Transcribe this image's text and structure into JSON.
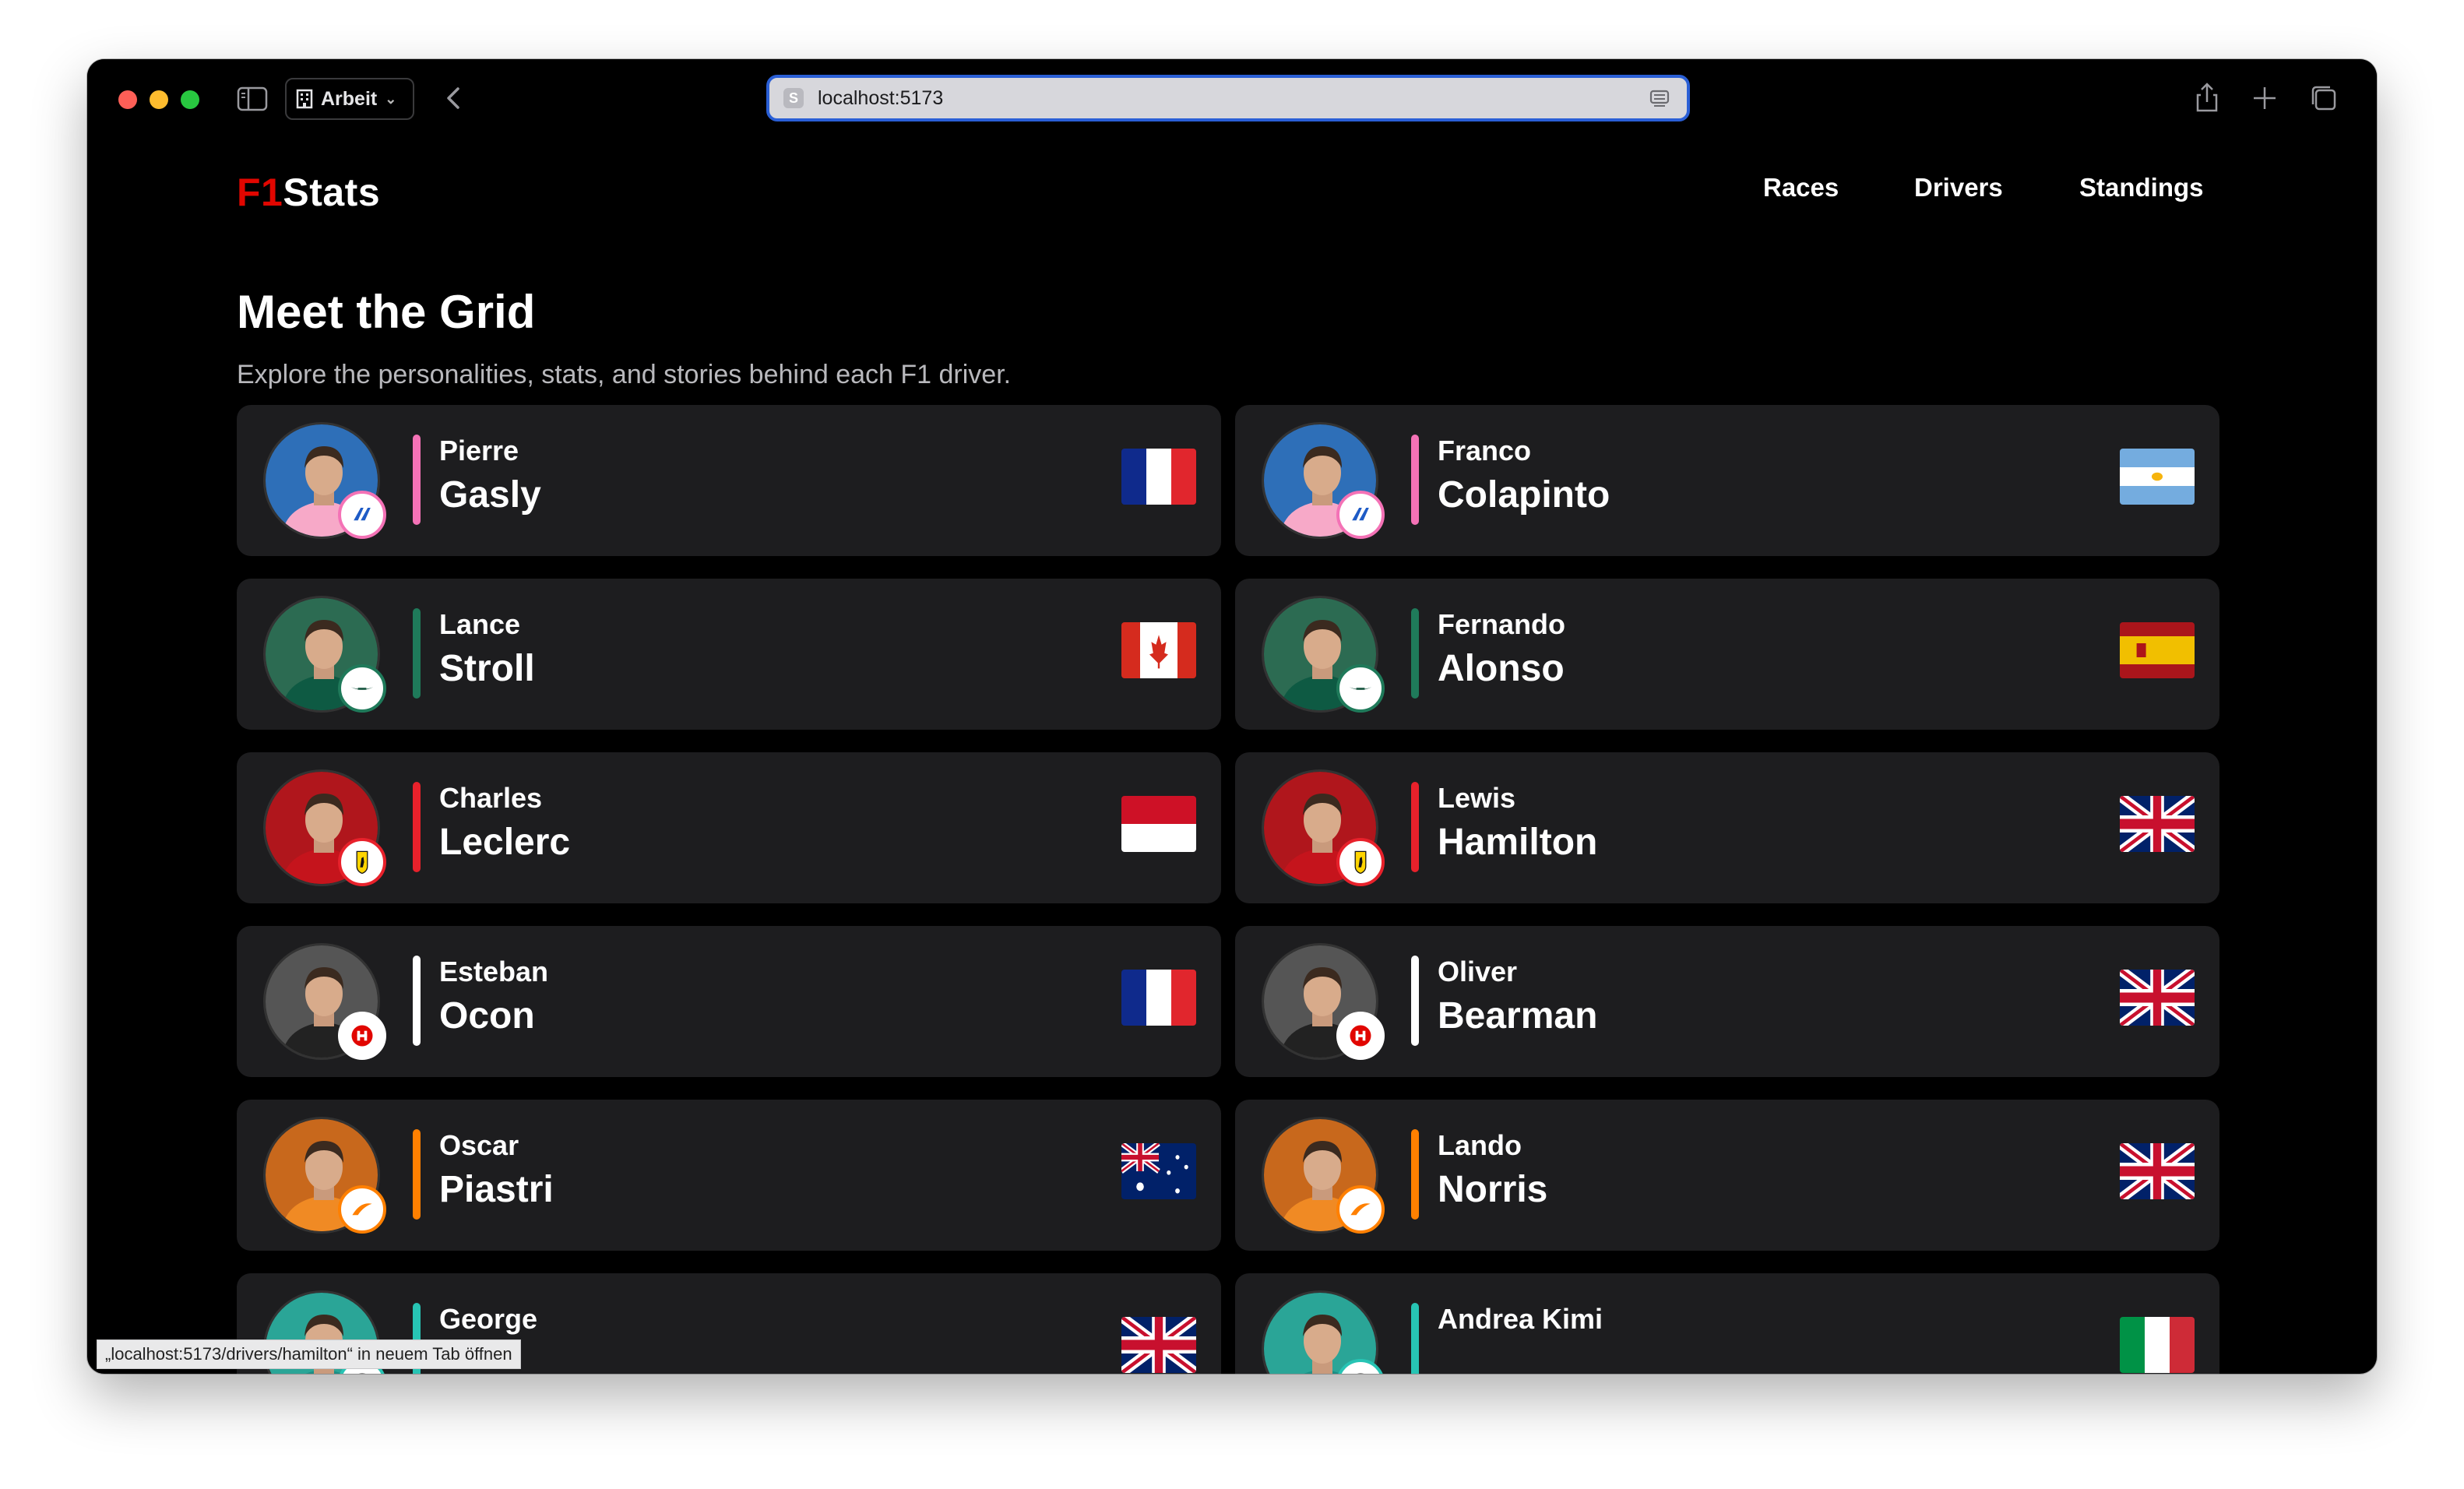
{
  "browser": {
    "tab_group": "Arbeit",
    "url": "localhost:5173",
    "status_tooltip": "„localhost:5173/drivers/hamilton“ in neuem Tab öffnen"
  },
  "site": {
    "logo_f1": "F1",
    "logo_stats": "Stats",
    "nav": [
      "Races",
      "Drivers",
      "Standings"
    ],
    "title": "Meet the Grid",
    "subtitle": "Explore the personalities, stats, and stories behind each F1 driver."
  },
  "colors": {
    "alpine": "#f472b6",
    "aston_martin": "#1f7a5a",
    "ferrari": "#e8212b",
    "haas": "#ffffff",
    "mclaren": "#ff8000",
    "mercedes": "#27c4b4",
    "brand_red": "#e10600"
  },
  "drivers": [
    {
      "first": "Pierre",
      "last": "Gasly",
      "team": "Alpine",
      "team_icon": "alpine-logo-icon",
      "country": "France"
    },
    {
      "first": "Franco",
      "last": "Colapinto",
      "team": "Alpine",
      "team_icon": "alpine-logo-icon",
      "country": "Argentina"
    },
    {
      "first": "Lance",
      "last": "Stroll",
      "team": "Aston Martin",
      "team_icon": "aston-martin-logo-icon",
      "country": "Canada"
    },
    {
      "first": "Fernando",
      "last": "Alonso",
      "team": "Aston Martin",
      "team_icon": "aston-martin-logo-icon",
      "country": "Spain"
    },
    {
      "first": "Charles",
      "last": "Leclerc",
      "team": "Ferrari",
      "team_icon": "ferrari-logo-icon",
      "country": "Monaco"
    },
    {
      "first": "Lewis",
      "last": "Hamilton",
      "team": "Ferrari",
      "team_icon": "ferrari-logo-icon",
      "country": "United Kingdom"
    },
    {
      "first": "Esteban",
      "last": "Ocon",
      "team": "Haas",
      "team_icon": "haas-logo-icon",
      "country": "France"
    },
    {
      "first": "Oliver",
      "last": "Bearman",
      "team": "Haas",
      "team_icon": "haas-logo-icon",
      "country": "United Kingdom"
    },
    {
      "first": "Oscar",
      "last": "Piastri",
      "team": "McLaren",
      "team_icon": "mclaren-logo-icon",
      "country": "Australia"
    },
    {
      "first": "Lando",
      "last": "Norris",
      "team": "McLaren",
      "team_icon": "mclaren-logo-icon",
      "country": "United Kingdom"
    },
    {
      "first": "George",
      "last": "",
      "team": "Mercedes",
      "team_icon": "mercedes-logo-icon",
      "country": "United Kingdom"
    },
    {
      "first": "Andrea Kimi",
      "last": "",
      "team": "Mercedes",
      "team_icon": "mercedes-logo-icon",
      "country": "Italy"
    }
  ]
}
